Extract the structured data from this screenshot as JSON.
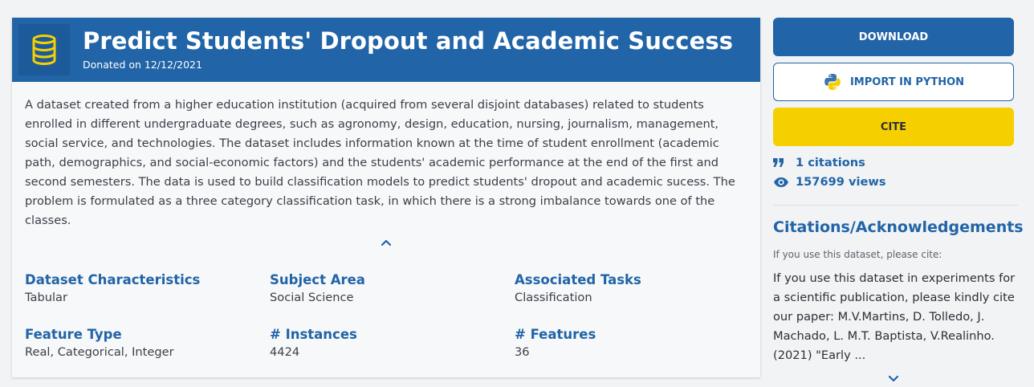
{
  "header": {
    "title": "Predict Students' Dropout and Academic Success",
    "donated": "Donated on 12/12/2021",
    "icon": "database-icon"
  },
  "description": "A dataset created from a higher education institution (acquired from several disjoint databases) related to students enrolled in different undergraduate degrees, such as agronomy, design, education, nursing, journalism, management, social service, and technologies. The dataset includes information known at the time of student enrollment (academic path, demographics, and social-economic factors) and the students' academic performance at the end of the first and second semesters. The data is used to build classification models to predict students' dropout and academic sucess. The problem is formulated as a three category classification task, in which there is a strong imbalance towards one of the classes.",
  "characteristics": [
    {
      "label": "Dataset Characteristics",
      "value": "Tabular"
    },
    {
      "label": "Subject Area",
      "value": "Social Science"
    },
    {
      "label": "Associated Tasks",
      "value": "Classification"
    },
    {
      "label": "Feature Type",
      "value": "Real, Categorical, Integer"
    },
    {
      "label": "# Instances",
      "value": "4424"
    },
    {
      "label": "# Features",
      "value": "36"
    }
  ],
  "actions": {
    "download": "DOWNLOAD",
    "import_python": "IMPORT IN PYTHON",
    "cite": "CITE"
  },
  "stats": {
    "citations": "1 citations",
    "views": "157699 views"
  },
  "citations": {
    "title": "Citations/Acknowledgements",
    "subtitle": "If you use this dataset, please cite:",
    "text": "If you use this dataset in experiments for a scientific publication, please kindly cite our paper: M.V.Martins, D. Tolledo, J. Machado, L. M.T. Baptista, V.Realinho. (2021) \"Early ..."
  },
  "colors": {
    "primary": "#2164a7",
    "accent_yellow": "#f6cf00",
    "background": "#f2f3f5"
  }
}
